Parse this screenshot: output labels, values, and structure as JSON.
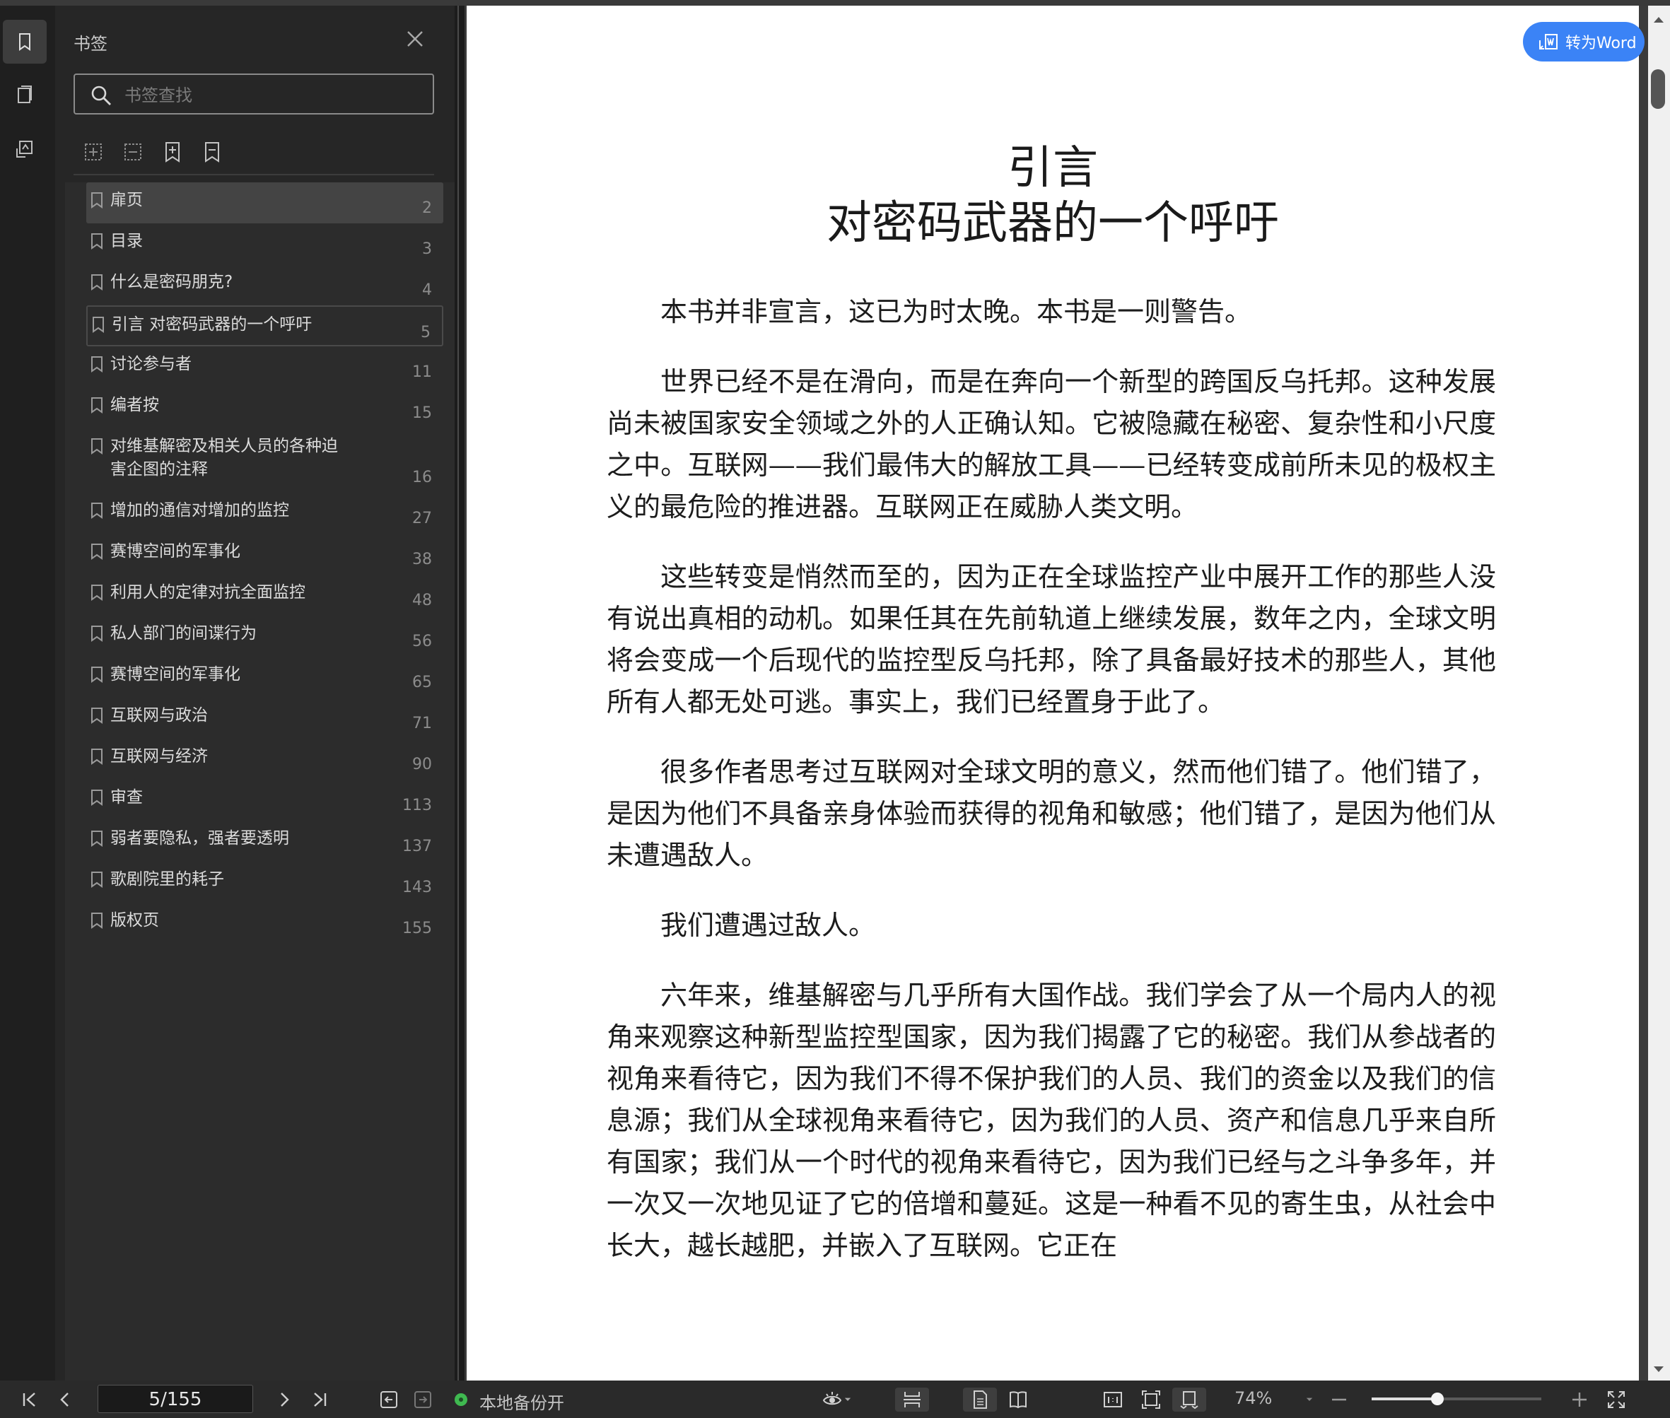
{
  "sidebar": {
    "title": "书签",
    "search_placeholder": "书签查找",
    "items": [
      {
        "label": "扉页",
        "page": "2"
      },
      {
        "label": "目录",
        "page": "3"
      },
      {
        "label": "什么是密码朋克?",
        "page": "4"
      },
      {
        "label": "引言 对密码武器的一个呼吁",
        "page": "5"
      },
      {
        "label": "讨论参与者",
        "page": "11"
      },
      {
        "label": "编者按",
        "page": "15"
      },
      {
        "label": "对维基解密及相关人员的各种迫害企图的注释",
        "page": "16"
      },
      {
        "label": "增加的通信对增加的监控",
        "page": "27"
      },
      {
        "label": "赛博空间的军事化",
        "page": "38"
      },
      {
        "label": "利用人的定律对抗全面监控",
        "page": "48"
      },
      {
        "label": "私人部门的间谍行为",
        "page": "56"
      },
      {
        "label": "赛博空间的军事化",
        "page": "65"
      },
      {
        "label": "互联网与政治",
        "page": "71"
      },
      {
        "label": "互联网与经济",
        "page": "90"
      },
      {
        "label": "审查",
        "page": "113"
      },
      {
        "label": "弱者要隐私，强者要透明",
        "page": "137"
      },
      {
        "label": "歌剧院里的耗子",
        "page": "143"
      },
      {
        "label": "版权页",
        "page": "155"
      }
    ]
  },
  "document": {
    "convert_button": "转为Word",
    "title_line1": "引言",
    "title_line2": "对密码武器的一个呼吁",
    "paragraphs": [
      "本书并非宣言，这已为时太晚。本书是一则警告。",
      "世界已经不是在滑向，而是在奔向一个新型的跨国反乌托邦。这种发展尚未被国家安全领域之外的人正确认知。它被隐藏在秘密、复杂性和小尺度之中。互联网——我们最伟大的解放工具——已经转变成前所未见的极权主义的最危险的推进器。互联网正在威胁人类文明。",
      "这些转变是悄然而至的，因为正在全球监控产业中展开工作的那些人没有说出真相的动机。如果任其在先前轨道上继续发展，数年之内，全球文明将会变成一个后现代的监控型反乌托邦，除了具备最好技术的那些人，其他所有人都无处可逃。事实上，我们已经置身于此了。",
      "很多作者思考过互联网对全球文明的意义，然而他们错了。他们错了，是因为他们不具备亲身体验而获得的视角和敏感；他们错了，是因为他们从未遭遇敌人。",
      "我们遭遇过敌人。",
      "六年来，维基解密与几乎所有大国作战。我们学会了从一个局内人的视角来观察这种新型监控型国家，因为我们揭露了它的秘密。我们从参战者的视角来看待它，因为我们不得不保护我们的人员、我们的资金以及我们的信息源；我们从全球视角来看待它，因为我们的人员、资产和信息几乎来自所有国家；我们从一个时代的视角来看待它，因为我们已经与之斗争多年，并一次又一次地见证了它的倍增和蔓延。这是一种看不见的寄生虫，从社会中长大，越长越肥，并嵌入了互联网。它正在"
    ]
  },
  "statusbar": {
    "page_indicator": "5/155",
    "backup_status": "本地备份开",
    "zoom": "74%"
  }
}
